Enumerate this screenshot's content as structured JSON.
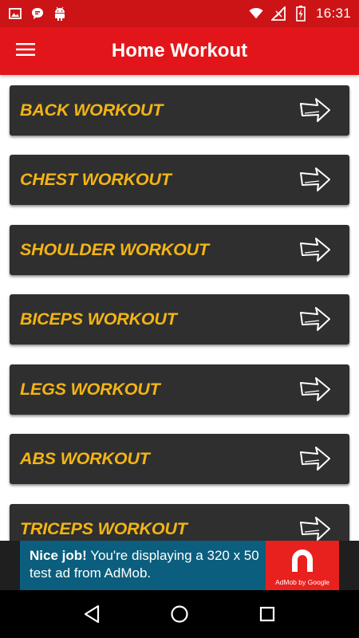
{
  "status_bar": {
    "time": "16:31",
    "left_icons": [
      "image-icon",
      "chat-icon",
      "android-icon"
    ],
    "right_icons": [
      "wifi-icon",
      "signal-icon",
      "battery-icon"
    ]
  },
  "app_bar": {
    "title": "Home Workout",
    "menu_icon": "hamburger-menu-icon",
    "color": "#e2161a"
  },
  "workouts": {
    "items": [
      {
        "label": "BACK WORKOUT"
      },
      {
        "label": "CHEST WORKOUT"
      },
      {
        "label": "SHOULDER WORKOUT"
      },
      {
        "label": "BICEPS WORKOUT"
      },
      {
        "label": "LEGS WORKOUT"
      },
      {
        "label": "ABS WORKOUT"
      },
      {
        "label": "TRICEPS WORKOUT"
      }
    ],
    "item_bg": "#2f2f2f",
    "label_color": "#f2b416",
    "arrow_icon": "arrow-right-icon"
  },
  "ad": {
    "headline": "Nice job!",
    "body": " You're displaying a 320 x 50 test ad from AdMob.",
    "logo_text": "AdMob by Google",
    "bg": "#0b5e7d",
    "logo_bg": "#e8211f"
  },
  "nav_bar": {
    "buttons": [
      "back-icon",
      "home-icon",
      "recents-icon"
    ]
  }
}
